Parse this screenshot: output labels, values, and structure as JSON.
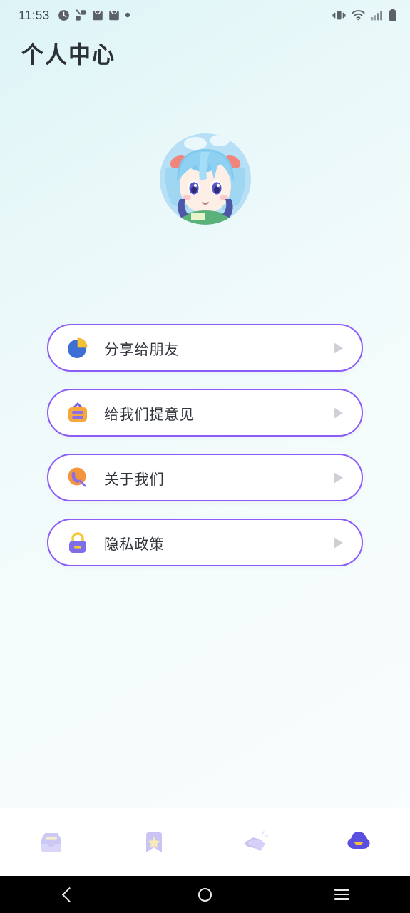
{
  "statusbar": {
    "time": "11:53",
    "left_icons": [
      "clock-icon",
      "share-nodes-icon",
      "shopping-bag-icon",
      "shopping-bag-icon",
      "dot-icon"
    ],
    "right_icons": [
      "vibrate-icon",
      "wifi-icon",
      "signal-icon",
      "battery-icon"
    ]
  },
  "header": {
    "title": "个人中心"
  },
  "profile": {
    "avatar_alt": "anime-avatar",
    "avatar_bg": "#bfe2f7",
    "hair_color": "#8fd0f0",
    "accent_color": "#f08a82"
  },
  "menu": {
    "items": [
      {
        "icon": "pie-share-icon",
        "label": "分享给朋友",
        "arrow": "play-arrow-icon"
      },
      {
        "icon": "feedback-board-icon",
        "label": "给我们提意见",
        "arrow": "play-arrow-icon"
      },
      {
        "icon": "about-phone-icon",
        "label": "关于我们",
        "arrow": "play-arrow-icon"
      },
      {
        "icon": "privacy-lock-icon",
        "label": "隐私政策",
        "arrow": "play-arrow-icon"
      }
    ]
  },
  "tabbar": {
    "tabs": [
      {
        "icon": "inbox-icon",
        "active": false
      },
      {
        "icon": "bookmark-star-icon",
        "active": false
      },
      {
        "icon": "price-tags-icon",
        "active": false
      },
      {
        "icon": "profile-cloud-icon",
        "active": true
      }
    ]
  },
  "navbar": {
    "back": "back-icon",
    "home": "home-icon",
    "recents": "recents-icon"
  },
  "colors": {
    "accent_purple": "#8b5cf6",
    "active_purple": "#5b4fe0",
    "accent_yellow": "#f5c842",
    "accent_orange": "#f2963c",
    "background_top": "#ddf4f7",
    "card_bg": "#ffffff",
    "arrow_gray": "#cfcfd6",
    "text_dark": "#30363c"
  }
}
